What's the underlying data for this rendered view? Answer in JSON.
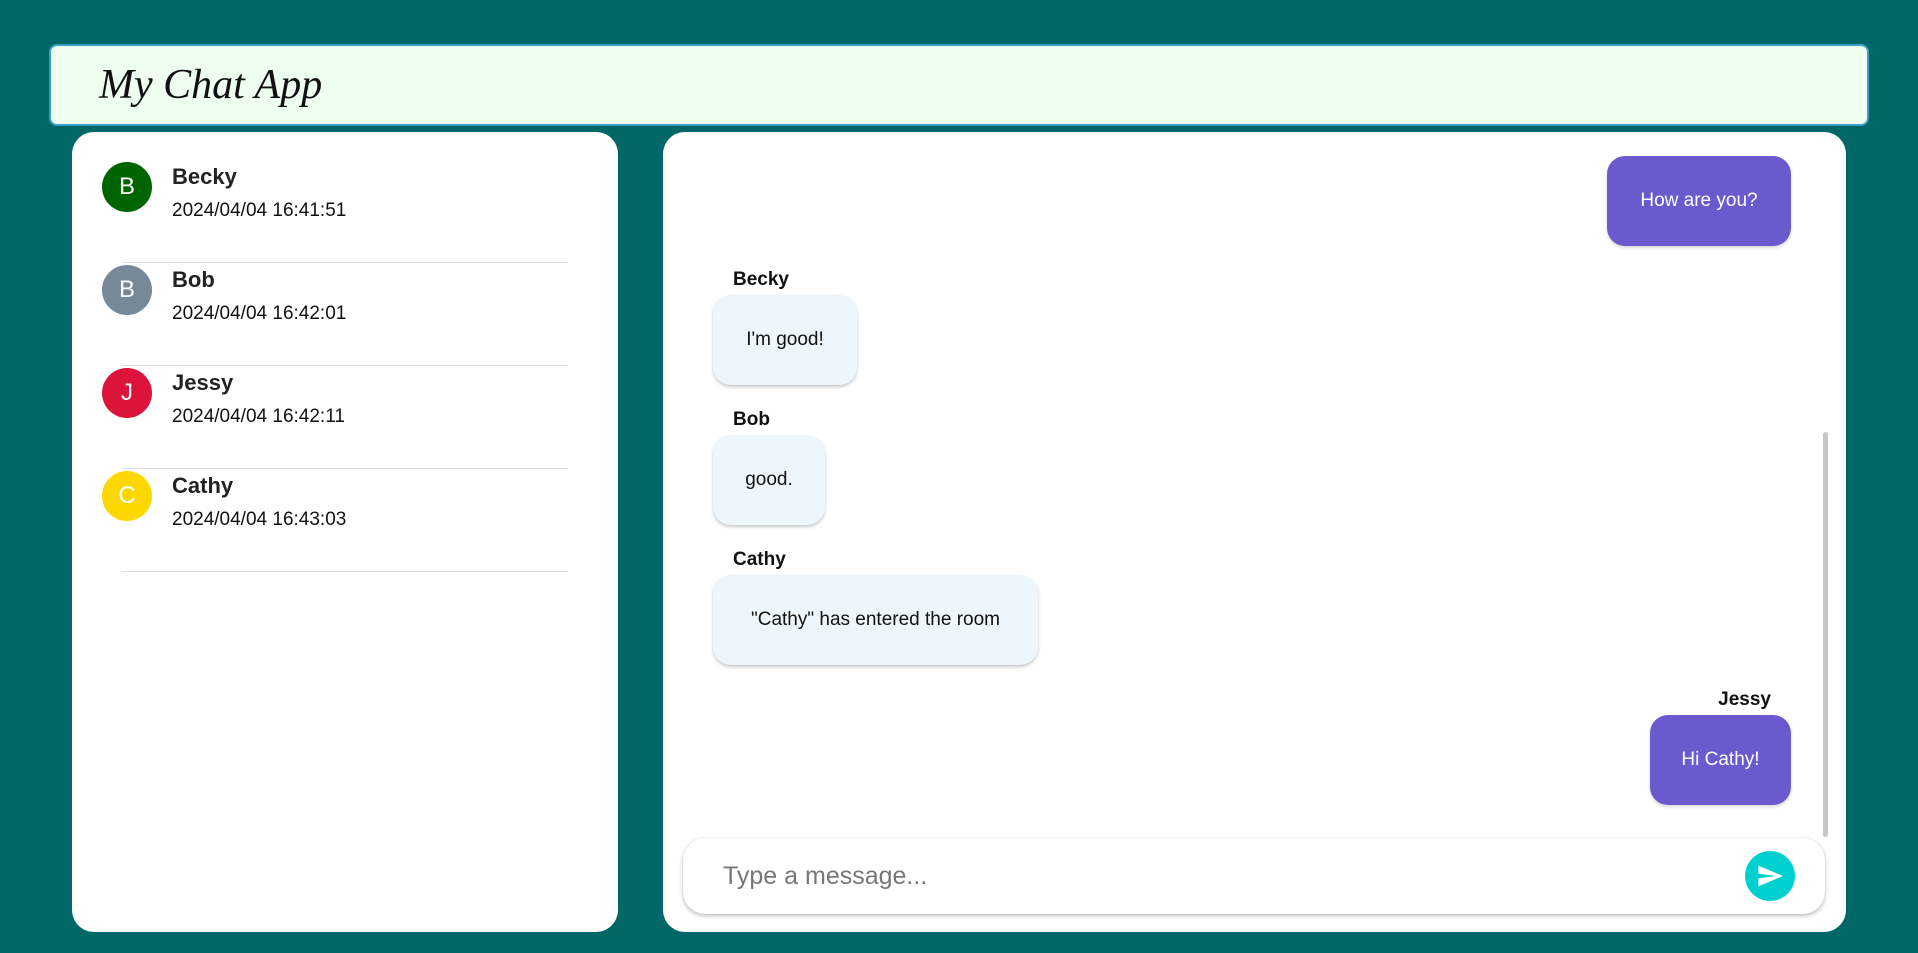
{
  "header": {
    "title": "My Chat App"
  },
  "contacts": [
    {
      "initial": "B",
      "name": "Becky",
      "time": "2024/04/04 16:41:51",
      "color": "#006400"
    },
    {
      "initial": "B",
      "name": "Bob",
      "time": "2024/04/04 16:42:01",
      "color": "#778899"
    },
    {
      "initial": "J",
      "name": "Jessy",
      "time": "2024/04/04 16:42:11",
      "color": "#dc143c"
    },
    {
      "initial": "C",
      "name": "Cathy",
      "time": "2024/04/04 16:43:03",
      "color": "#ffd700"
    }
  ],
  "messages": [
    {
      "sender": "",
      "text": "How are you?",
      "outgoing": true
    },
    {
      "sender": "Becky",
      "text": "I'm good!",
      "outgoing": false
    },
    {
      "sender": "Bob",
      "text": "good.",
      "outgoing": false
    },
    {
      "sender": "Cathy",
      "text": "\"Cathy\" has entered the room",
      "outgoing": false
    },
    {
      "sender": "Jessy",
      "text": "Hi Cathy!",
      "outgoing": true
    }
  ],
  "composer": {
    "placeholder": "Type a message...",
    "value": ""
  },
  "colors": {
    "background": "#006666",
    "outgoing_bubble": "#6a5acd",
    "incoming_bubble": "#eef6fd",
    "send_button": "#00cfcf"
  }
}
